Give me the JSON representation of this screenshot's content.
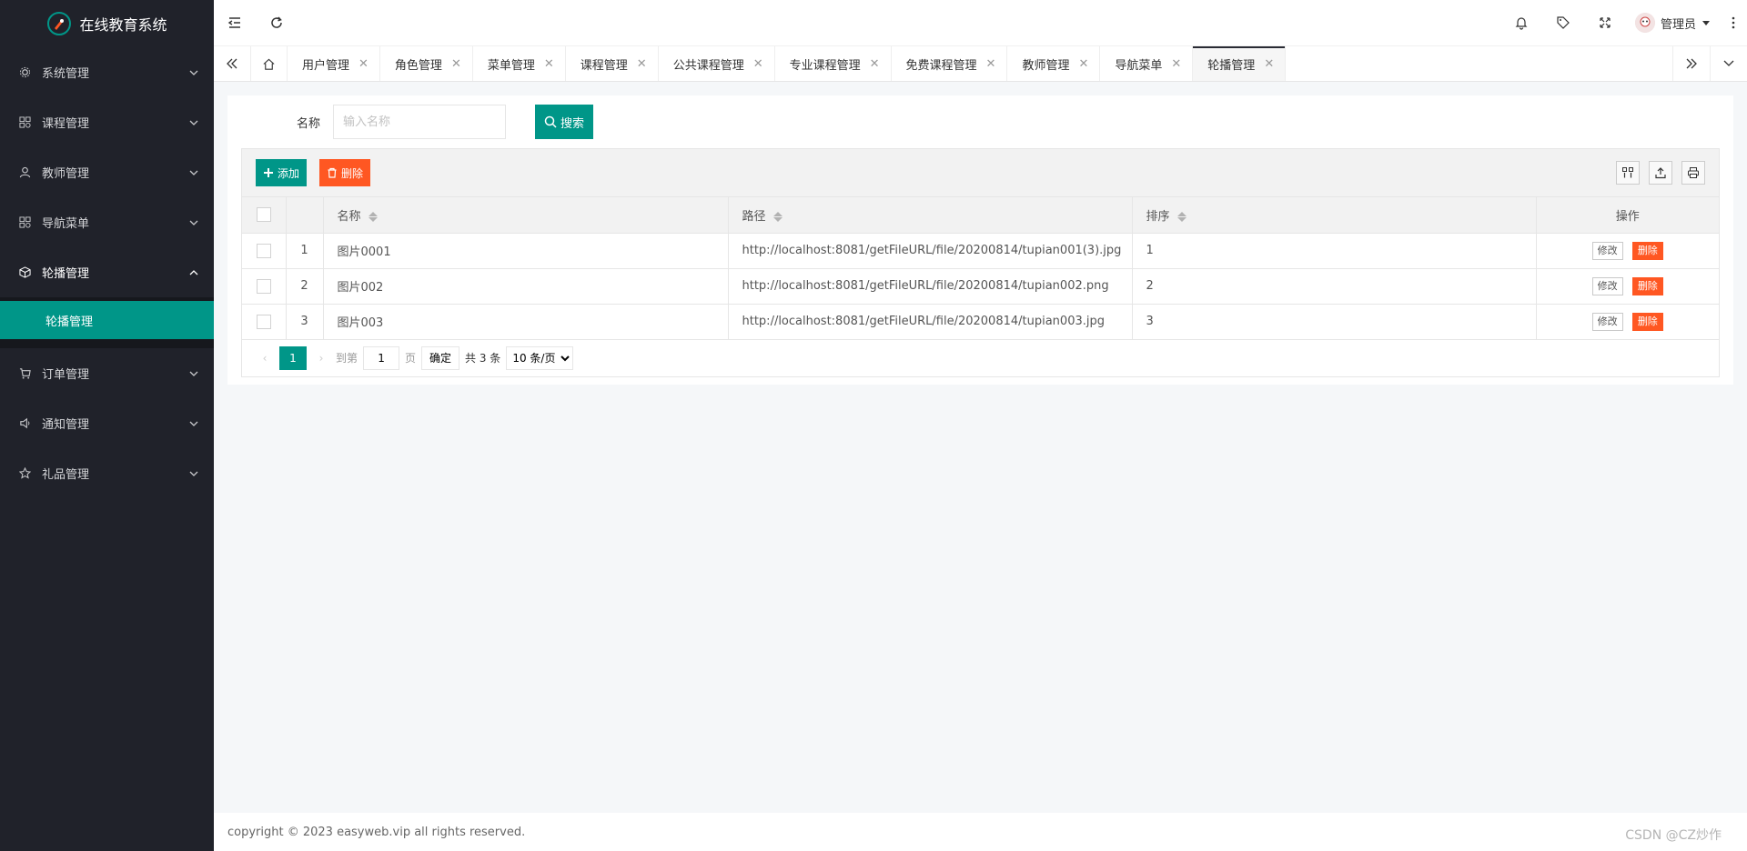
{
  "app": {
    "title": "在线教育系统"
  },
  "sidebar": {
    "items": [
      {
        "label": "系统管理",
        "icon": "gear-icon"
      },
      {
        "label": "课程管理",
        "icon": "apps-icon"
      },
      {
        "label": "教师管理",
        "icon": "user-icon"
      },
      {
        "label": "导航菜单",
        "icon": "apps-icon"
      },
      {
        "label": "轮播管理",
        "icon": "cube-icon",
        "open": true,
        "sub": [
          {
            "label": "轮播管理",
            "active": true
          }
        ]
      },
      {
        "label": "订单管理",
        "icon": "cart-icon"
      },
      {
        "label": "通知管理",
        "icon": "speaker-icon"
      },
      {
        "label": "礼品管理",
        "icon": "star-icon"
      }
    ]
  },
  "header": {
    "user_label": "管理员"
  },
  "tabs": [
    {
      "label": "用户管理"
    },
    {
      "label": "角色管理"
    },
    {
      "label": "菜单管理"
    },
    {
      "label": "课程管理"
    },
    {
      "label": "公共课程管理"
    },
    {
      "label": "专业课程管理"
    },
    {
      "label": "免费课程管理"
    },
    {
      "label": "教师管理"
    },
    {
      "label": "导航菜单"
    },
    {
      "label": "轮播管理",
      "active": true
    }
  ],
  "search": {
    "label": "名称",
    "placeholder": "输入名称",
    "button": "搜索"
  },
  "toolbar": {
    "add_label": "添加",
    "delete_label": "删除"
  },
  "table": {
    "columns": {
      "name": "名称",
      "path": "路径",
      "sort": "排序",
      "ops": "操作"
    },
    "rows": [
      {
        "num": "1",
        "name": "图片0001",
        "path": "http://localhost:8081/getFileURL/file/20200814/tupian001(3).jpg",
        "sort": "1"
      },
      {
        "num": "2",
        "name": "图片002",
        "path": "http://localhost:8081/getFileURL/file/20200814/tupian002.png",
        "sort": "2"
      },
      {
        "num": "3",
        "name": "图片003",
        "path": "http://localhost:8081/getFileURL/file/20200814/tupian003.jpg",
        "sort": "3"
      }
    ],
    "edit_label": "修改",
    "delete_label": "删除"
  },
  "pager": {
    "current": "1",
    "goto_label": "到第",
    "goto_value": "1",
    "page_label": "页",
    "confirm_label": "确定",
    "total_label": "共 3 条",
    "page_size": "10 条/页"
  },
  "footer": {
    "copyright": "copyright © 2023 easyweb.vip all rights reserved."
  },
  "watermark": "CSDN @CZ炒作"
}
